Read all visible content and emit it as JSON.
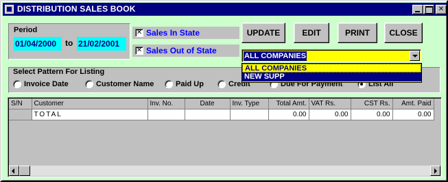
{
  "window": {
    "title": "DISTRIBUTION SALES BOOK",
    "controls": [
      "minimize-icon",
      "maximize-icon",
      "close-icon"
    ]
  },
  "period": {
    "label": "Period",
    "from_date": "01/04/2000",
    "to_label": "to",
    "to_date": "21/02/2001"
  },
  "filters": {
    "sales_in_state": {
      "label": "Sales In State",
      "checked": true
    },
    "sales_out_of_state": {
      "label": "Sales Out of State",
      "checked": true
    }
  },
  "buttons": {
    "update": "UPDATE",
    "edit": "EDIT",
    "print": "PRINT",
    "close": "CLOSE"
  },
  "company_combo": {
    "selected": "ALL COMPANIES",
    "options": [
      "ALL COMPANIES",
      "NEW SUPP"
    ]
  },
  "pattern": {
    "legend": "Select Pattern For Listing",
    "options": [
      {
        "label": "Invoice Date",
        "selected": false
      },
      {
        "label": "Customer Name",
        "selected": false
      },
      {
        "label": "Paid Up",
        "selected": false
      },
      {
        "label": "Credit",
        "selected": false
      },
      {
        "label": "Due For Payment",
        "selected": false
      },
      {
        "label": "List All",
        "selected": true
      }
    ]
  },
  "grid": {
    "columns": [
      "S/N",
      "Customer",
      "Inv. No.",
      "Date",
      "Inv. Type",
      "Total Amt.",
      "VAT  Rs.",
      "CST Rs.",
      "Amt. Paid"
    ],
    "rows": [
      [
        "",
        "TOTAL",
        "",
        "",
        "",
        "0.00",
        "0.00",
        "0.00",
        "0.00"
      ]
    ]
  },
  "colors": {
    "form_background": "#ccffcc",
    "titlebar": "#000080",
    "date_fields": "#00ffff",
    "combo_background": "#ffff00",
    "checkbox_label": "#0000ff"
  }
}
